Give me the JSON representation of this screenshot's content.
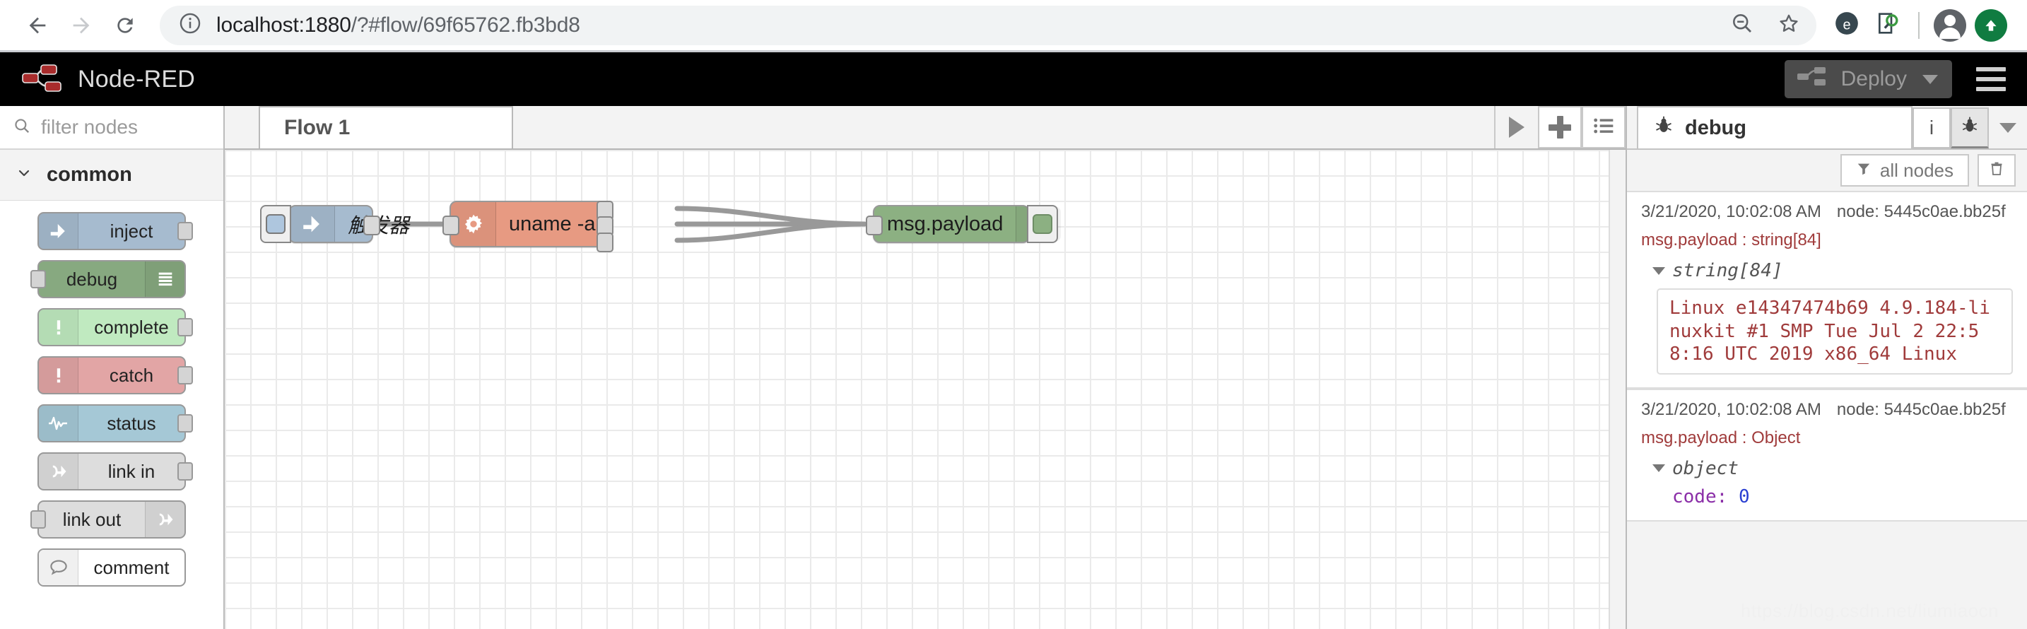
{
  "browser": {
    "back_icon": "back-arrow-icon",
    "forward_icon": "forward-arrow-icon",
    "reload_icon": "reload-icon",
    "info_icon": "site-info-icon",
    "url_host": "localhost:1880",
    "url_path": "/?#flow/69f65762.fb3bd8",
    "url_full": "localhost:1880/?#flow/69f65762.fb3bd8",
    "zoom_out_icon": "zoom-out-icon",
    "bookmark_icon": "star-bookmark-icon",
    "extension1_icon": "extension-icon",
    "extension2_icon": "extension-inspect-icon",
    "profile_icon": "profile-avatar-icon",
    "update_icon": "update-arrow-icon"
  },
  "nr_header": {
    "logo_icon": "node-red-logo-icon",
    "title": "Node-RED",
    "deploy_label": "Deploy",
    "deploy_icon": "deploy-icon",
    "deploy_caret_icon": "chevron-down-icon",
    "menu_icon": "hamburger-menu-icon"
  },
  "palette": {
    "search_icon": "search-icon",
    "filter_placeholder": "filter nodes",
    "category": {
      "chevron_icon": "chevron-down-icon",
      "label": "common"
    },
    "nodes": [
      {
        "label": "inject",
        "icon": "inject-arrow-icon",
        "color": "#a6bbcf",
        "icon_side": "left",
        "port": "out"
      },
      {
        "label": "debug",
        "icon": "debug-lines-icon",
        "color": "#87a980",
        "icon_side": "right",
        "port": "in"
      },
      {
        "label": "complete",
        "icon": "exclamation-icon",
        "color": "#c0eac0",
        "icon_side": "left",
        "port": "out"
      },
      {
        "label": "catch",
        "icon": "exclamation-icon",
        "color": "#e2a5a5",
        "icon_side": "left",
        "port": "out"
      },
      {
        "label": "status",
        "icon": "pulse-wave-icon",
        "color": "#a5c8d6",
        "icon_side": "left",
        "port": "out"
      },
      {
        "label": "link in",
        "icon": "link-arrow-icon",
        "color": "#dddddd",
        "icon_side": "left",
        "port": "out"
      },
      {
        "label": "link out",
        "icon": "link-arrow-icon",
        "color": "#dddddd",
        "icon_side": "right",
        "port": "in"
      },
      {
        "label": "comment",
        "icon": "speech-bubble-icon",
        "color": "#ffffff",
        "icon_side": "left",
        "port": "none"
      }
    ]
  },
  "workspace": {
    "tabs": [
      {
        "label": "Flow 1",
        "active": true
      }
    ],
    "controls": {
      "scroll_right_icon": "play-triangle-icon",
      "add_flow_icon": "plus-icon",
      "list_flows_icon": "list-icon"
    },
    "watermark": "https://blog.csdn.net/liumiaocn",
    "nodes": [
      {
        "id": "inject-node",
        "label": "触发器",
        "type": "inject",
        "icon": "inject-arrow-icon",
        "color": "#a6bbcf",
        "button_icon": "inject-button-icon"
      },
      {
        "id": "exec-node",
        "label": "uname -a",
        "type": "exec",
        "icon": "gear-icon",
        "color": "#e79a82",
        "outputs": 3
      },
      {
        "id": "debug-node",
        "label": "msg.payload",
        "type": "debug",
        "icon": "debug-lines-icon",
        "color": "#8cb082",
        "toggle_icon": "debug-toggle-icon"
      }
    ]
  },
  "sidebar": {
    "tab": {
      "label": "debug",
      "icon": "bug-icon"
    },
    "info_button": "i",
    "info_button_icon": "info-icon",
    "debug_button_icon": "bug-icon",
    "caret_icon": "chevron-down-icon",
    "filter_icon": "filter-icon",
    "filter_label": "all nodes",
    "clear_icon": "trash-icon",
    "messages": [
      {
        "timestamp": "3/21/2020, 10:02:08 AM",
        "node_label": "node: 5445c0ae.bb25f",
        "topic": "msg.payload : string[84]",
        "type_label": "string[84]",
        "value": "Linux e14347474b69 4.9.184-linuxkit #1 SMP Tue Jul 2 22:58:16 UTC 2019 x86_64 Linux",
        "kind": "string"
      },
      {
        "timestamp": "3/21/2020, 10:02:08 AM",
        "node_label": "node: 5445c0ae.bb25f",
        "topic": "msg.payload : Object",
        "type_label": "object",
        "kind": "object",
        "properties": [
          {
            "key": "code:",
            "value": "0"
          }
        ]
      }
    ]
  },
  "colors": {
    "node_red_header": "#000000",
    "deploy_button": "#4b4b4b",
    "inject_node": "#a6bbcf",
    "exec_node": "#e79a82",
    "debug_node": "#8cb082",
    "debug_string_value": "#a03b3b",
    "debug_object_key": "#8b2fa8",
    "debug_object_value": "#2a3fd1"
  }
}
